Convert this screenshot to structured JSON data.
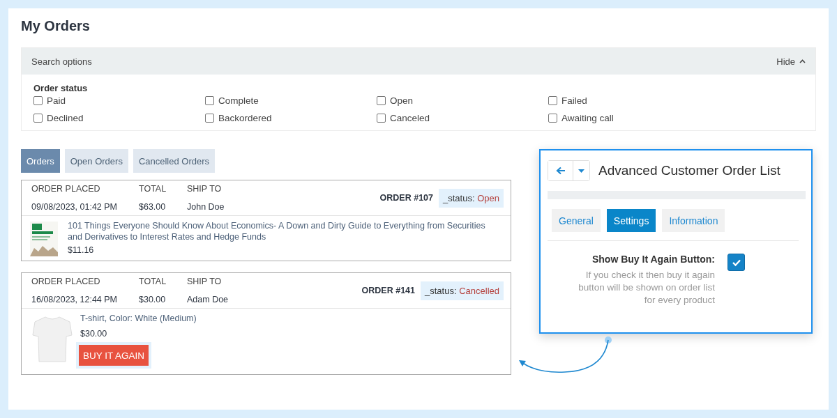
{
  "title": "My Orders",
  "search_options": {
    "label": "Search options",
    "toggle": "Hide",
    "group_label": "Order status",
    "statuses": [
      {
        "label": "Paid",
        "checked": false
      },
      {
        "label": "Complete",
        "checked": false
      },
      {
        "label": "Open",
        "checked": false
      },
      {
        "label": "Failed",
        "checked": false
      },
      {
        "label": "Declined",
        "checked": false
      },
      {
        "label": "Backordered",
        "checked": false
      },
      {
        "label": "Canceled",
        "checked": false
      },
      {
        "label": "Awaiting call",
        "checked": false
      }
    ]
  },
  "tabs": [
    {
      "label": "Orders",
      "selected": true
    },
    {
      "label": "Open Orders",
      "selected": false
    },
    {
      "label": "Cancelled Orders",
      "selected": false
    }
  ],
  "orders": [
    {
      "columns": [
        "ORDER PLACED",
        "TOTAL",
        "SHIP TO"
      ],
      "placed": "09/08/2023, 01:42 PM",
      "total": "$63.00",
      "ship_to": "John Doe",
      "order_number": "ORDER #107",
      "status_label": "_status:",
      "status": "Open",
      "items": [
        {
          "kind": "book",
          "title": "101 Things Everyone Should Know About Economics-  A Down and Dirty Guide to Everything from Securities and Derivatives to Interest Rates and Hedge Funds",
          "price": "$11.16"
        }
      ]
    },
    {
      "columns": [
        "ORDER PLACED",
        "TOTAL",
        "SHIP TO"
      ],
      "placed": "16/08/2023, 12:44 PM",
      "total": "$30.00",
      "ship_to": "Adam Doe",
      "order_number": "ORDER #141",
      "status_label": "_status:",
      "status": "Cancelled",
      "items": [
        {
          "kind": "tshirt",
          "title": "T-shirt, Color: White (Medium)",
          "price": "$30.00",
          "buy_again": "BUY IT AGAIN"
        }
      ]
    }
  ],
  "settings_panel": {
    "title": "Advanced Customer Order List",
    "tabs": [
      {
        "label": "General",
        "selected": false
      },
      {
        "label": "Settings",
        "selected": true
      },
      {
        "label": "Information",
        "selected": false
      }
    ],
    "setting": {
      "label": "Show Buy It Again Button:",
      "help": "If you check it then buy it again button will be shown on order list for every product",
      "checked": true
    }
  }
}
